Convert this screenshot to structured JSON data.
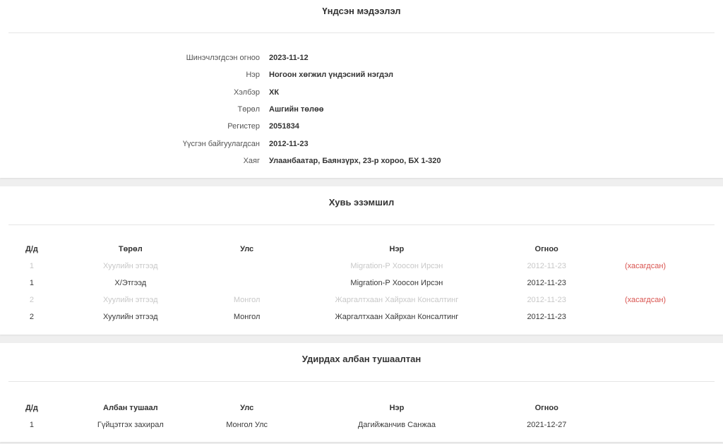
{
  "basic": {
    "title": "Үндсэн мэдээлэл",
    "rows": [
      {
        "label": "Шинэчлэгдсэн огноо",
        "value": "2023-11-12"
      },
      {
        "label": "Нэр",
        "value": "Ногоон хөгжил үндэсний нэгдэл"
      },
      {
        "label": "Хэлбэр",
        "value": "ХК"
      },
      {
        "label": "Төрөл",
        "value": "Ашгийн төлөө"
      },
      {
        "label": "Регистер",
        "value": "2051834"
      },
      {
        "label": "Үүсгэн байгуулагдсан",
        "value": "2012-11-23"
      },
      {
        "label": "Хаяг",
        "value": "Улаанбаатар, Баянзүрх, 23-р хороо, БХ 1-320"
      }
    ]
  },
  "ownership": {
    "title": "Хувь эзэмшил",
    "headers": {
      "idx": "Д/д",
      "type": "Төрөл",
      "country": "Улс",
      "name": "Нэр",
      "date": "Огноо"
    },
    "rows": [
      {
        "idx": "1",
        "type": "Хуулийн этгээд",
        "country": "",
        "name": "Migration-Р Хоосон Ирсэн",
        "date": "2012-11-23",
        "status": "(хасагдсан)",
        "removed": true
      },
      {
        "idx": "1",
        "type": "Х/Этгээд",
        "country": "",
        "name": "Migration-Р Хоосон Ирсэн",
        "date": "2012-11-23",
        "status": "",
        "removed": false
      },
      {
        "idx": "2",
        "type": "Хуулийн этгээд",
        "country": "Монгол",
        "name": "Жаргалтхаан Хайрхан Консалтинг",
        "date": "2012-11-23",
        "status": "(хасагдсан)",
        "removed": true
      },
      {
        "idx": "2",
        "type": "Хуулийн этгээд",
        "country": "Монгол",
        "name": "Жаргалтхаан Хайрхан Консалтинг",
        "date": "2012-11-23",
        "status": "",
        "removed": false
      }
    ]
  },
  "officials": {
    "title": "Удирдах албан тушаалтан",
    "headers": {
      "idx": "Д/д",
      "position": "Албан тушаал",
      "country": "Улс",
      "name": "Нэр",
      "date": "Огноо"
    },
    "rows": [
      {
        "idx": "1",
        "position": "Гүйцэтгэх захирал",
        "country": "Монгол Улс",
        "name": "Дагийжанчив Санжаа",
        "date": "2021-12-27"
      }
    ]
  },
  "colors": {
    "removed_status": "#d9534f",
    "removed_row_text": "#c8c8c8"
  }
}
